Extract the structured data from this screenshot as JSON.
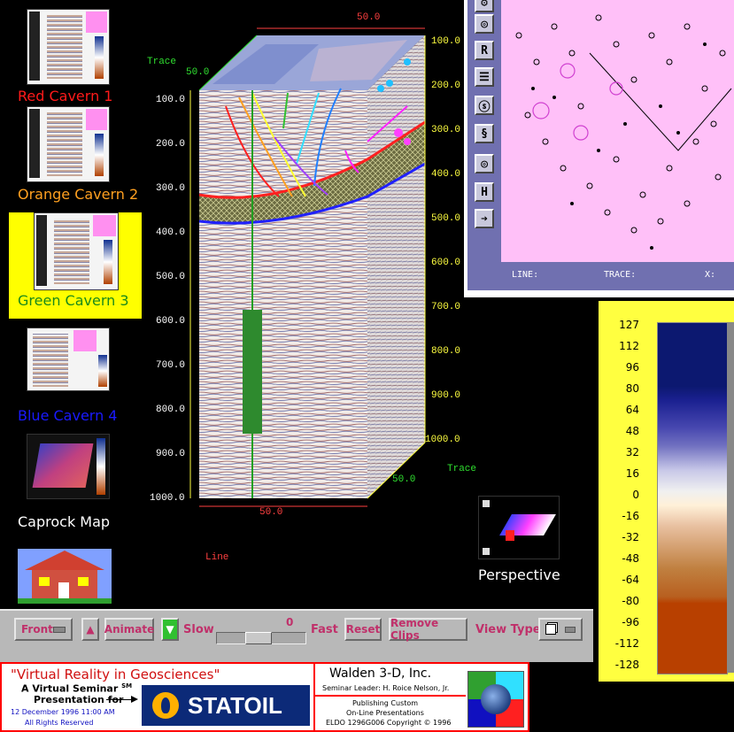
{
  "cavern_list": [
    {
      "label": "Red Cavern 1",
      "color": "#ff1a1a"
    },
    {
      "label": "Orange Cavern 2",
      "color": "#ffa020"
    },
    {
      "label": "Green Cavern 3",
      "color": "#1a8a1a"
    },
    {
      "label": "Blue Cavern 4",
      "color": "#1a1aff"
    }
  ],
  "caprock_label": "Caprock Map",
  "perspective_label": "Perspective",
  "seismic_cube": {
    "time_axis_left": [
      "100.0",
      "200.0",
      "300.0",
      "400.0",
      "500.0",
      "600.0",
      "700.0",
      "800.0",
      "900.0",
      "1000.0"
    ],
    "time_axis_right": [
      "100.0",
      "200.0",
      "300.0",
      "400.0",
      "500.0",
      "600.0",
      "700.0",
      "800.0",
      "900.0",
      "1000.0"
    ],
    "top_label": "50.0",
    "trace_left_label": "Trace",
    "trace_left_value": "50.0",
    "trace_right_label": "Trace",
    "trace_right_value": "50.0",
    "bottom_value": "50.0",
    "line_label": "Line"
  },
  "basemap_panel": {
    "status_line": "LINE:",
    "status_trace": "TRACE:",
    "status_x": "X:",
    "tool_icons": [
      "gear-icon",
      "spiral-icon",
      "r-icon",
      "list-icon",
      "swirl-icon",
      "scroll-icon",
      "target-icon",
      "h-icon",
      "export-icon"
    ],
    "tool_glyphs": [
      "⚙",
      "◎",
      "R",
      "☰",
      "ⓢ",
      "§",
      "◎",
      "H",
      "➔"
    ]
  },
  "colorbar": {
    "ticks": [
      "127",
      "112",
      "96",
      "80",
      "64",
      "48",
      "32",
      "16",
      "0",
      "-16",
      "-32",
      "-48",
      "-64",
      "-80",
      "-96",
      "-112",
      "-128"
    ]
  },
  "toolbar": {
    "view_select": "Front",
    "animate_label": "Animate",
    "slow_label": "Slow",
    "speed_value": "0",
    "speed_fraction": 0.45,
    "fast_label": "Fast",
    "reset_label": "Reset",
    "remove_clips_label": "Remove Clips",
    "view_type_label": "View Type"
  },
  "banner": {
    "title": "\"Virtual Reality in Geosciences\"",
    "subtitle": "A Virtual Seminar",
    "sm_mark": "SM",
    "presentation_for": "Presentation for",
    "date": "12 December 1996  11:00 AM",
    "rights": "All Rights Reserved",
    "sponsor_logo": "STATOIL",
    "company": "Walden 3-D, Inc.",
    "leader": "Seminar Leader: H. Roice Nelson, Jr.",
    "publishing_line1": "Publishing Custom",
    "publishing_line2": "On-Line Presentations",
    "copyright": "ELDO 1296G006 Copyright © 1996"
  },
  "colors": {
    "background": "#000000",
    "panel_gray": "#b8b8b8",
    "label_pink": "#c0306a",
    "basemap_pink": "#ffc0f8",
    "toolbar_blue": "#7070b0",
    "highlight_yellow": "#ffff00",
    "axis_yellow": "#ffff40"
  }
}
